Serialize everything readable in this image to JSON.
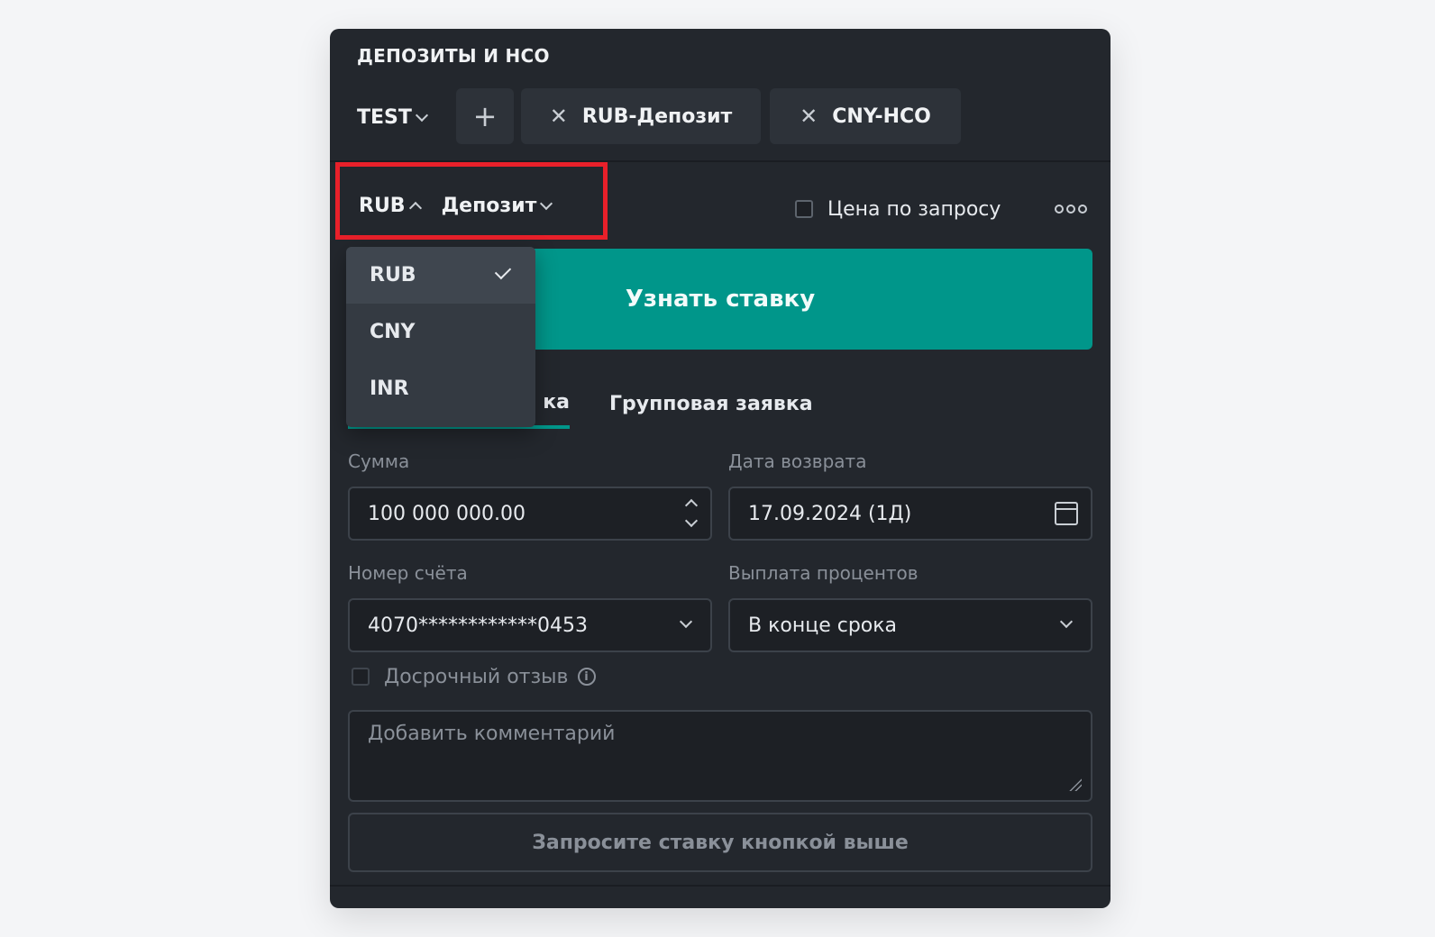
{
  "widget": {
    "title": "ДЕПОЗИТЫ И НСО",
    "account": "TEST",
    "tabs": [
      {
        "label": "RUB-Депозит"
      },
      {
        "label": "CNY-НСО"
      }
    ]
  },
  "selector": {
    "currency": "RUB",
    "product": "Депозит",
    "price_on_request": "Цена по запросу"
  },
  "currency_menu": {
    "options": [
      "RUB",
      "CNY",
      "INR"
    ],
    "selected": "RUB"
  },
  "cta": {
    "label": "Узнать ставку"
  },
  "mode_tabs": {
    "single_visible": "ка",
    "group": "Групповая заявка"
  },
  "form": {
    "amount_label": "Сумма",
    "amount_value": "100 000 000.00",
    "return_date_label": "Дата возврата",
    "return_date_value": "17.09.2024 (1Д)",
    "account_label": "Номер счёта",
    "account_value": "4070************0453",
    "payout_label": "Выплата процентов",
    "payout_value": "В конце срока",
    "early_withdrawal": "Досрочный отзыв",
    "comment_placeholder": "Добавить комментарий",
    "submit_label": "Запросите ставку кнопкой выше"
  },
  "colors": {
    "accent": "#00968a",
    "panel_bg": "#23272d",
    "highlight": "#e8202a"
  }
}
